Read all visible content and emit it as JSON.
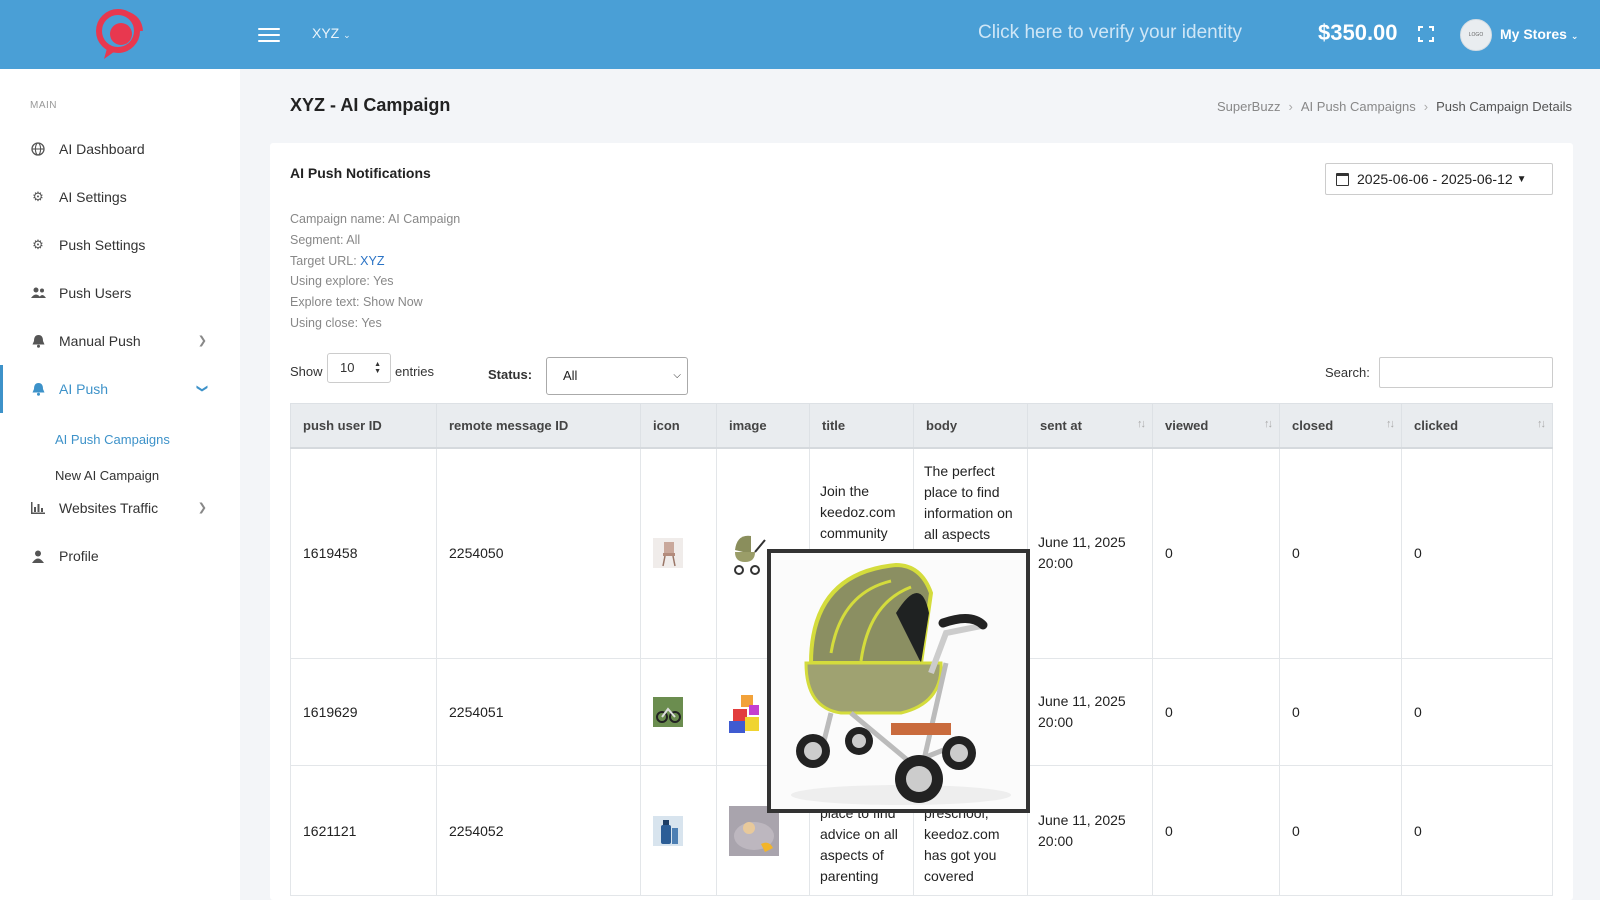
{
  "header": {
    "store_name": "XYZ",
    "verify_text": "Click here to verify your identity",
    "balance": "$350.00",
    "account_label": "My Stores",
    "avatar_text": "LOGO"
  },
  "sidebar": {
    "section_label": "MAIN",
    "items": [
      {
        "label": "AI Dashboard"
      },
      {
        "label": "AI Settings"
      },
      {
        "label": "Push Settings"
      },
      {
        "label": "Push Users"
      },
      {
        "label": "Manual Push"
      },
      {
        "label": "AI Push"
      },
      {
        "label": "Websites Traffic"
      },
      {
        "label": "Profile"
      }
    ],
    "sub_items": [
      {
        "label": "AI Push Campaigns"
      },
      {
        "label": "New AI Campaign"
      }
    ]
  },
  "page": {
    "title": "XYZ - AI Campaign",
    "breadcrumb": [
      "SuperBuzz",
      "AI Push Campaigns",
      "Push Campaign Details"
    ]
  },
  "card": {
    "title": "AI Push Notifications",
    "date_range": "2025-06-06 - 2025-06-12",
    "meta": {
      "campaign_label": "Campaign name: AI Campaign",
      "segment_label": "Segment: All",
      "target_prefix": "Target URL: ",
      "target_value": "XYZ",
      "explore_label": "Using explore: Yes",
      "explore_text_label": "Explore text: Show Now",
      "close_label": "Using close: Yes"
    },
    "controls": {
      "show_label": "Show",
      "entries_value": "10",
      "entries_label": "entries",
      "status_label": "Status:",
      "status_value": "All",
      "search_label": "Search:"
    }
  },
  "table": {
    "columns": [
      "push user ID",
      "remote message ID",
      "icon",
      "image",
      "title",
      "body",
      "sent at",
      "viewed",
      "closed",
      "clicked"
    ],
    "rows": [
      {
        "push_user_id": "1619458",
        "remote_message_id": "2254050",
        "title": "Join the keedoz.com community",
        "body": "The perfect place to find information on all aspects",
        "sent_at": "June 11, 2025 20:00",
        "viewed": "0",
        "closed": "0",
        "clicked": "0"
      },
      {
        "push_user_id": "1619629",
        "remote_message_id": "2254051",
        "title": "",
        "body": "",
        "sent_at": "June 11, 2025 20:00",
        "viewed": "0",
        "closed": "0",
        "clicked": "0"
      },
      {
        "push_user_id": "1621121",
        "remote_message_id": "2254052",
        "title": "place to find advice on all aspects of parenting",
        "body": "pregnancy to preschool, keedoz.com has got you covered",
        "sent_at": "June 11, 2025 20:00",
        "viewed": "0",
        "closed": "0",
        "clicked": "0"
      }
    ]
  },
  "colors": {
    "header_bg": "#4a9fd6",
    "accent": "#3d92c9",
    "logo": "#e8384f",
    "link": "#2a73c5"
  }
}
